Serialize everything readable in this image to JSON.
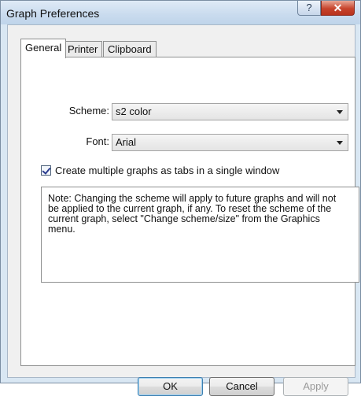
{
  "window": {
    "title": "Graph Preferences",
    "help_glyph": "?",
    "close_glyph": "✕"
  },
  "tabs": [
    {
      "label": "General",
      "selected": true
    },
    {
      "label": "Printer",
      "selected": false
    },
    {
      "label": "Clipboard",
      "selected": false
    }
  ],
  "general": {
    "scheme_label": "Scheme:",
    "scheme_value": "s2 color",
    "font_label": "Font:",
    "font_value": "Arial",
    "tabs_checkbox_label": "Create multiple graphs as tabs in a single window",
    "tabs_checkbox_checked": true,
    "note_lines": [
      "Note:  Changing the scheme will apply to future graphs and will not",
      "be applied to the current graph, if any.  To reset the scheme of the",
      "current graph, select \"Change scheme/size\" from the Graphics",
      "menu."
    ]
  },
  "buttons": {
    "ok": "OK",
    "cancel": "Cancel",
    "apply": "Apply"
  },
  "icons": {
    "help": "help-icon",
    "close": "close-icon",
    "dropdown": "chevron-down-icon",
    "check": "checkmark-icon"
  },
  "colors": {
    "titlebar": "#c9dbee",
    "close_button": "#c7442c",
    "dialog_background": "#f0f0f0",
    "default_button_border": "#3c7fb1"
  }
}
